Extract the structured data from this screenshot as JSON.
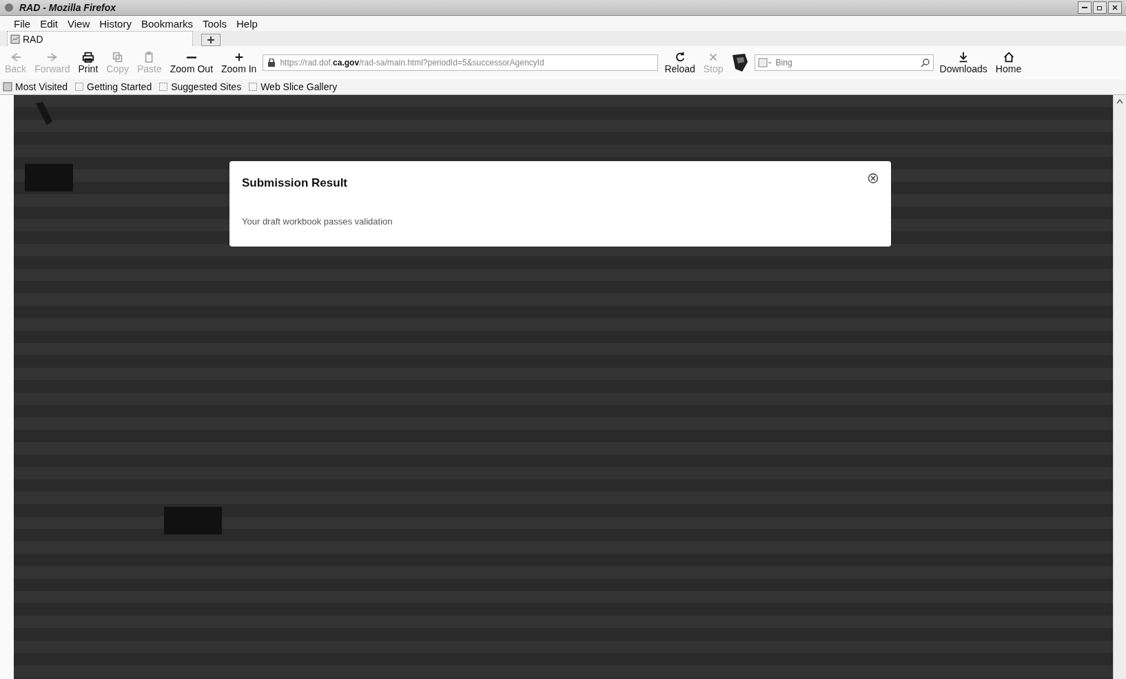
{
  "window": {
    "title": "RAD - Mozilla Firefox"
  },
  "menu": [
    "File",
    "Edit",
    "View",
    "History",
    "Bookmarks",
    "Tools",
    "Help"
  ],
  "tabs": [
    {
      "label": "RAD",
      "selected": true
    }
  ],
  "toolbar_left": [
    {
      "label": "Back",
      "kind": "back",
      "disabled": true
    },
    {
      "label": "Forward",
      "kind": "forward",
      "disabled": true
    },
    {
      "label": "Print",
      "kind": "print",
      "disabled": false
    },
    {
      "label": "Copy",
      "kind": "copy",
      "disabled": true
    },
    {
      "label": "Paste",
      "kind": "paste",
      "disabled": true
    },
    {
      "label": "Zoom Out",
      "kind": "zoom-out",
      "disabled": false
    },
    {
      "label": "Zoom In",
      "kind": "zoom-in",
      "disabled": false
    }
  ],
  "address": {
    "value": "https://rad.dof.**ca.gov**/rad-sa/main.html?periodId=5&successorAgencyId"
  },
  "toolbar_right": [
    {
      "label": "Reload",
      "kind": "reload",
      "disabled": false
    },
    {
      "label": "Stop",
      "kind": "stop",
      "disabled": true
    }
  ],
  "search": {
    "placeholder": "Bing"
  },
  "toolbar_end": [
    {
      "label": "Downloads",
      "kind": "downloads",
      "disabled": false
    },
    {
      "label": "Home",
      "kind": "home",
      "disabled": false
    }
  ],
  "bookmarks": [
    {
      "label": "Most Visited",
      "kind": "smart"
    },
    {
      "label": "Getting Started",
      "kind": "page"
    },
    {
      "label": "Suggested Sites",
      "kind": "page"
    },
    {
      "label": "Web Slice Gallery",
      "kind": "page"
    }
  ],
  "modal": {
    "title": "Submission Result",
    "message": "Your draft workbook passes validation"
  }
}
